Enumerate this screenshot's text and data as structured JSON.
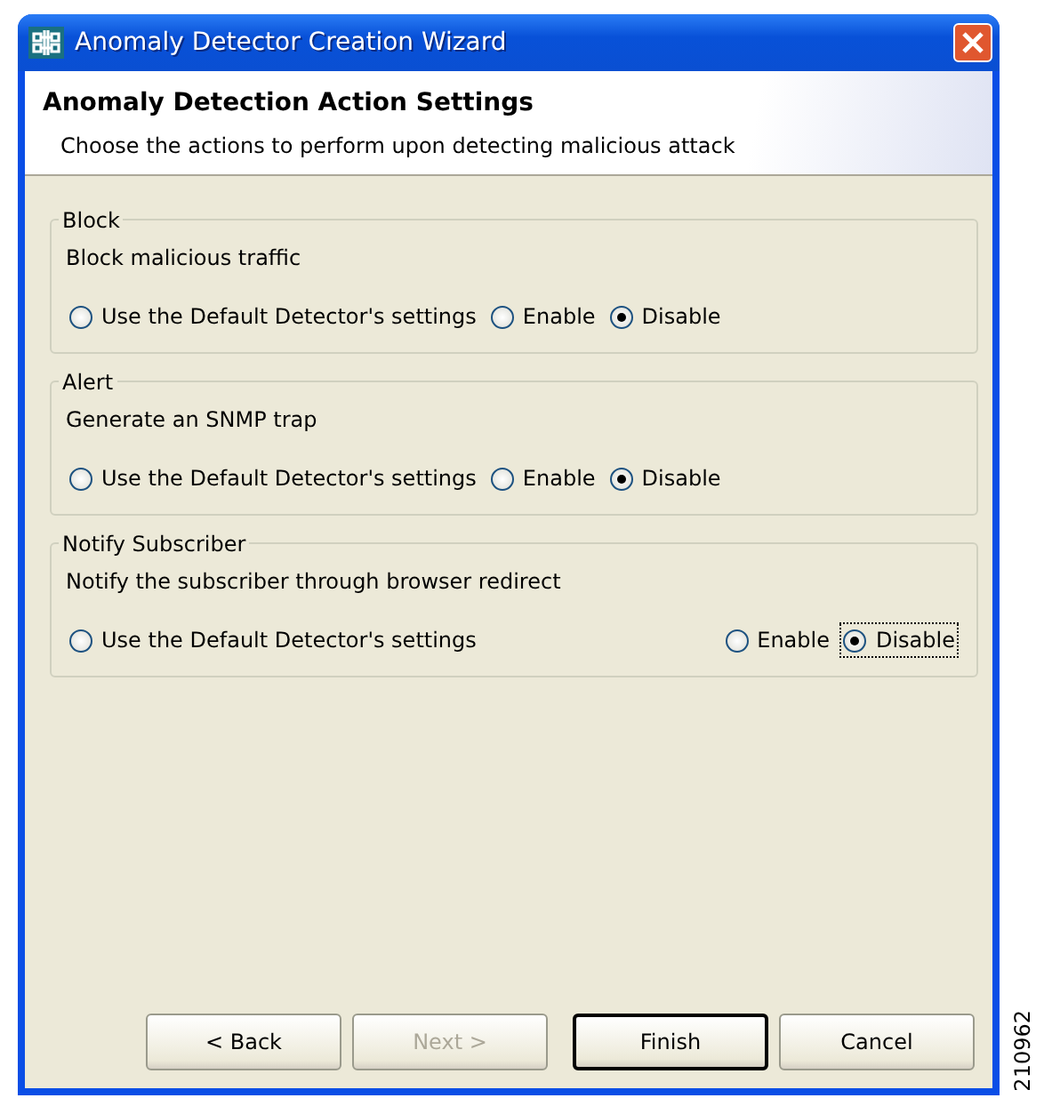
{
  "window": {
    "title": "Anomaly Detector Creation Wizard"
  },
  "header": {
    "title": "Anomaly Detection Action Settings",
    "description": "Choose the actions to perform upon detecting malicious attack"
  },
  "groups": [
    {
      "title": "Block",
      "description": "Block malicious traffic",
      "wide": false,
      "options": [
        {
          "label": "Use the Default Detector's settings",
          "selected": false,
          "focused": false
        },
        {
          "label": "Enable",
          "selected": false,
          "focused": false
        },
        {
          "label": "Disable",
          "selected": true,
          "focused": false
        }
      ]
    },
    {
      "title": "Alert",
      "description": "Generate an SNMP trap",
      "wide": false,
      "options": [
        {
          "label": "Use the Default Detector's settings",
          "selected": false,
          "focused": false
        },
        {
          "label": "Enable",
          "selected": false,
          "focused": false
        },
        {
          "label": "Disable",
          "selected": true,
          "focused": false
        }
      ]
    },
    {
      "title": "Notify Subscriber",
      "description": "Notify the subscriber through browser redirect",
      "wide": true,
      "options": [
        {
          "label": "Use the Default Detector's settings",
          "selected": false,
          "focused": false
        },
        {
          "label": "Enable",
          "selected": false,
          "focused": false
        },
        {
          "label": "Disable",
          "selected": true,
          "focused": true
        }
      ]
    }
  ],
  "buttons": [
    {
      "label": "< Back",
      "disabled": false,
      "default": false
    },
    {
      "label": "Next >",
      "disabled": true,
      "default": false
    },
    {
      "label": "Finish",
      "disabled": false,
      "default": true
    },
    {
      "label": "Cancel",
      "disabled": false,
      "default": false
    }
  ],
  "figure_number": "210962"
}
